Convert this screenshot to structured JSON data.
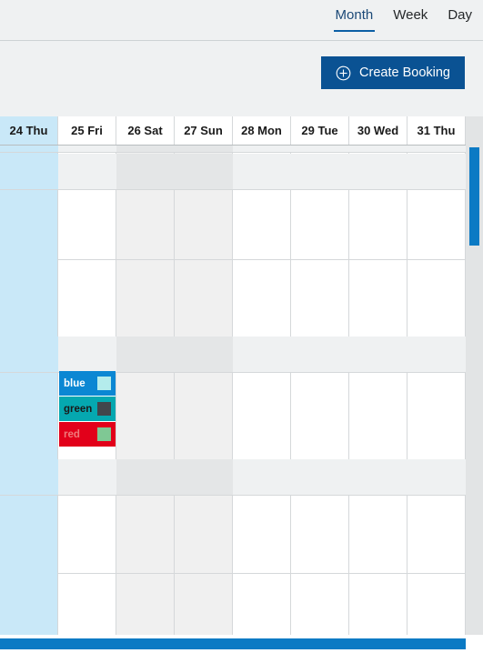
{
  "view_tabs": {
    "items": [
      {
        "label": "Month",
        "active": true
      },
      {
        "label": "Week",
        "active": false
      },
      {
        "label": "Day",
        "active": false
      }
    ]
  },
  "toolbar": {
    "create_booking_label": "Create Booking",
    "create_booking_icon": "circle-plus-icon",
    "accent_color": "#0a5293"
  },
  "calendar": {
    "today_highlight_color": "#c9e8f8",
    "weekend_shade_color": "#f0f0f0",
    "columns": [
      {
        "label": "24 Thu",
        "day": "24",
        "weekday": "Thu",
        "today": true,
        "weekend": false
      },
      {
        "label": "25 Fri",
        "day": "25",
        "weekday": "Fri",
        "today": false,
        "weekend": false
      },
      {
        "label": "26 Sat",
        "day": "26",
        "weekday": "Sat",
        "today": false,
        "weekend": true
      },
      {
        "label": "27 Sun",
        "day": "27",
        "weekday": "Sun",
        "today": false,
        "weekend": true
      },
      {
        "label": "28 Mon",
        "day": "28",
        "weekday": "Mon",
        "today": false,
        "weekend": false
      },
      {
        "label": "29 Tue",
        "day": "29",
        "weekday": "Tue",
        "today": false,
        "weekend": false
      },
      {
        "label": "30 Wed",
        "day": "30",
        "weekday": "Wed",
        "today": false,
        "weekend": false
      },
      {
        "label": "31 Thu",
        "day": "31",
        "weekday": "Thu",
        "today": false,
        "weekend": false
      }
    ],
    "bookings": [
      {
        "label": "blue",
        "column": "25 Fri",
        "background": "#0b87d3",
        "text_color": "#ffffff",
        "swatch_color": "#b4ecec"
      },
      {
        "label": "green",
        "column": "25 Fri",
        "background": "#05a8b0",
        "text_color": "#1a1a1a",
        "swatch_color": "#41464c"
      },
      {
        "label": "red",
        "column": "25 Fri",
        "background": "#e2001a",
        "text_color": "#f07a7a",
        "swatch_color": "#7fc894"
      }
    ]
  },
  "scrollbars": {
    "vertical_thumb_color": "#0b7ac4",
    "horizontal_thumb_color": "#0b7ac4"
  }
}
